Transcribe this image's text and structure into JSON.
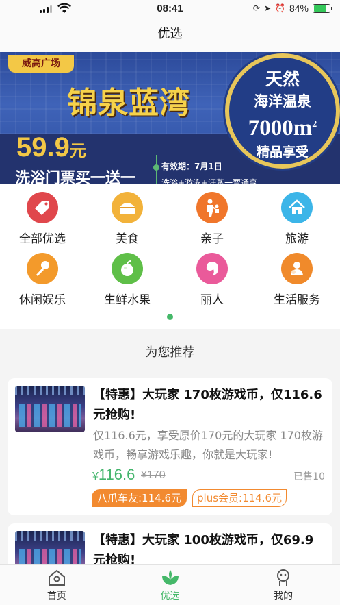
{
  "status_bar": {
    "time": "08:41",
    "battery": "84%"
  },
  "nav": {
    "title": "优选"
  },
  "banner": {
    "badge": "威高广场",
    "title": "锦泉蓝湾",
    "price": "59.9",
    "price_unit": "元",
    "subtitle": "洗浴门票买一送一",
    "valid": "有效期：7月1日",
    "items": "洗浴+游泳+汗蒸一票通享",
    "circle_line1": "天然",
    "circle_line2": "海洋温泉",
    "circle_area": "7000m",
    "circle_area_sup": "2",
    "circle_line4": "精品享受"
  },
  "categories": [
    {
      "label": "全部优选",
      "icon": "tag-icon",
      "color": "#e0474c"
    },
    {
      "label": "美食",
      "icon": "cake-icon",
      "color": "#f2b23a"
    },
    {
      "label": "亲子",
      "icon": "parent-child-icon",
      "color": "#f0762b"
    },
    {
      "label": "旅游",
      "icon": "house-icon",
      "color": "#3cb5e8"
    },
    {
      "label": "休闲娱乐",
      "icon": "microphone-icon",
      "color": "#f39a2b"
    },
    {
      "label": "生鲜水果",
      "icon": "apple-icon",
      "color": "#5fbf48"
    },
    {
      "label": "丽人",
      "icon": "woman-icon",
      "color": "#ea5a9a"
    },
    {
      "label": "生活服务",
      "icon": "service-icon",
      "color": "#f08a2b"
    }
  ],
  "section": {
    "title": "为您推荐"
  },
  "products": [
    {
      "title": "【特惠】大玩家 170枚游戏币，仅116.6元抢购!",
      "desc": "仅116.6元，享受原价170元的大玩家 170枚游戏币，畅享游戏乐趣，你就是大玩家!",
      "currency": "¥",
      "price": "116.6",
      "original_price": "¥170",
      "sold": "已售10",
      "tag1": "八爪车友:114.6元",
      "tag2": "plus会员:114.6元"
    },
    {
      "title": "【特惠】大玩家 100枚游戏币，仅69.9元抢购!"
    }
  ],
  "tabs": [
    {
      "label": "首页",
      "icon": "home-icon"
    },
    {
      "label": "优选",
      "icon": "leaf-icon",
      "active": true
    },
    {
      "label": "我的",
      "icon": "profile-icon"
    }
  ],
  "colors": {
    "accent": "#45b869",
    "orange": "#f28a30"
  }
}
